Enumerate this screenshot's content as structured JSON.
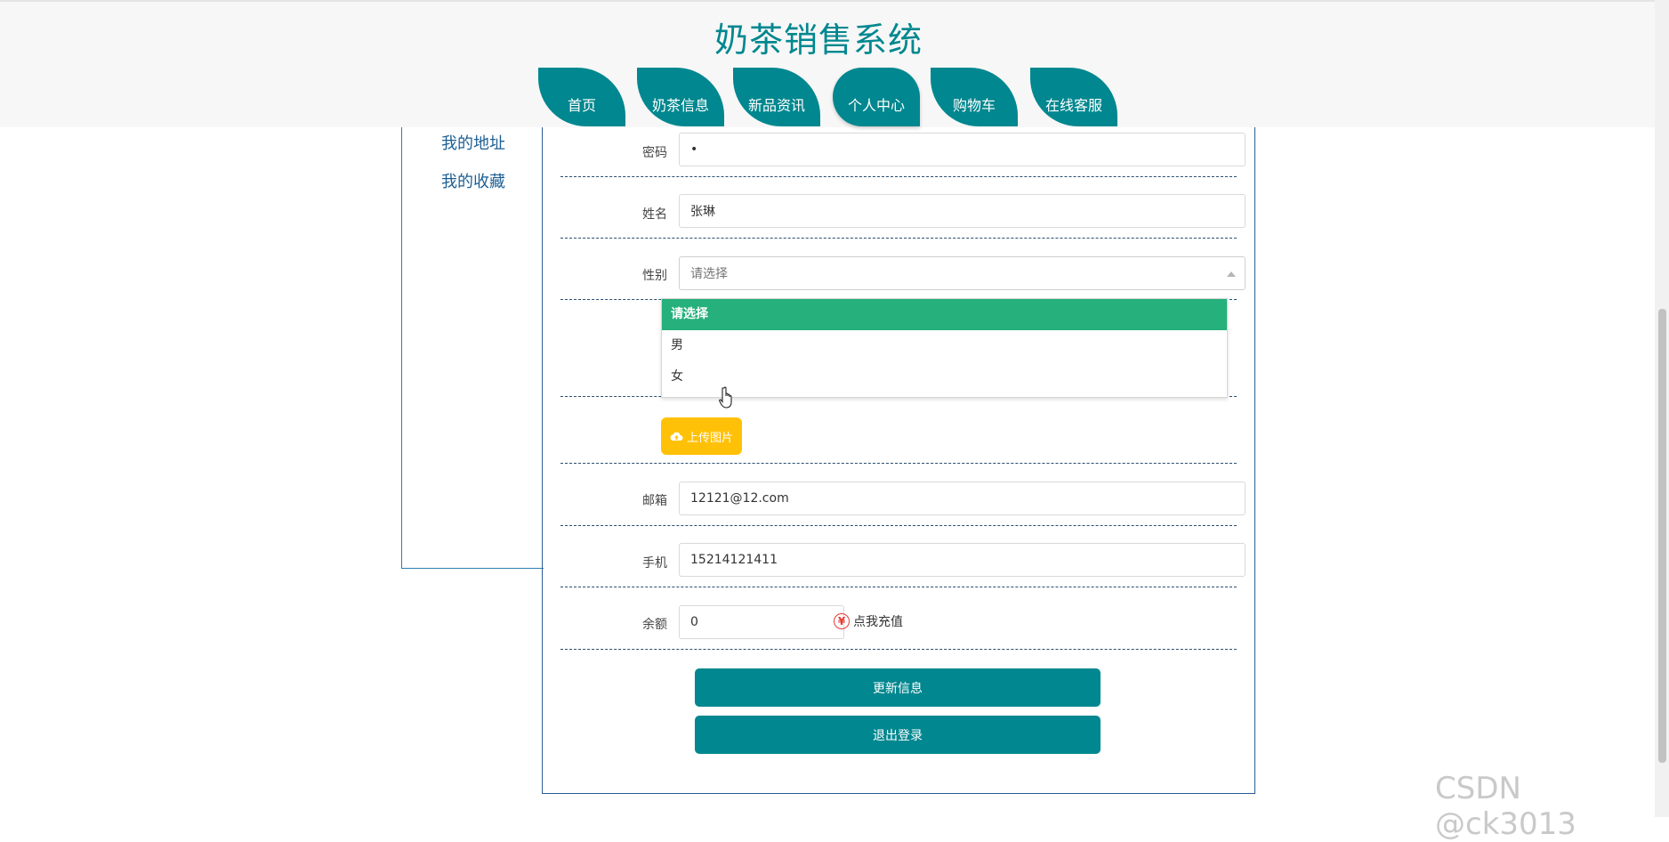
{
  "site": {
    "title": "奶茶销售系统"
  },
  "nav": {
    "items": [
      {
        "label": "首页"
      },
      {
        "label": "奶茶信息"
      },
      {
        "label": "新品资讯"
      },
      {
        "label": "个人中心"
      },
      {
        "label": "购物车"
      },
      {
        "label": "在线客服"
      }
    ],
    "active_index": 3
  },
  "sidebar": {
    "items": [
      {
        "label": "我的地址"
      },
      {
        "label": "我的收藏"
      }
    ]
  },
  "form": {
    "password": {
      "label": "密码",
      "value": "•"
    },
    "name": {
      "label": "姓名",
      "value": "张琳"
    },
    "gender": {
      "label": "性别",
      "placeholder": "请选择",
      "options": [
        "请选择",
        "男",
        "女"
      ],
      "highlighted_index": 0
    },
    "upload": {
      "label": "上传图片"
    },
    "email": {
      "label": "邮箱",
      "value": "12121@12.com"
    },
    "phone": {
      "label": "手机",
      "value": "15214121411"
    },
    "balance": {
      "label": "余额",
      "value": "0",
      "recharge_label": "点我充值",
      "recharge_icon": "¥"
    },
    "update_button": "更新信息",
    "logout_button": "退出登录"
  },
  "watermark": "CSDN @ck3013",
  "colors": {
    "primary": "#00878f",
    "upload": "#ffc107",
    "selected_option": "#26b07b"
  }
}
